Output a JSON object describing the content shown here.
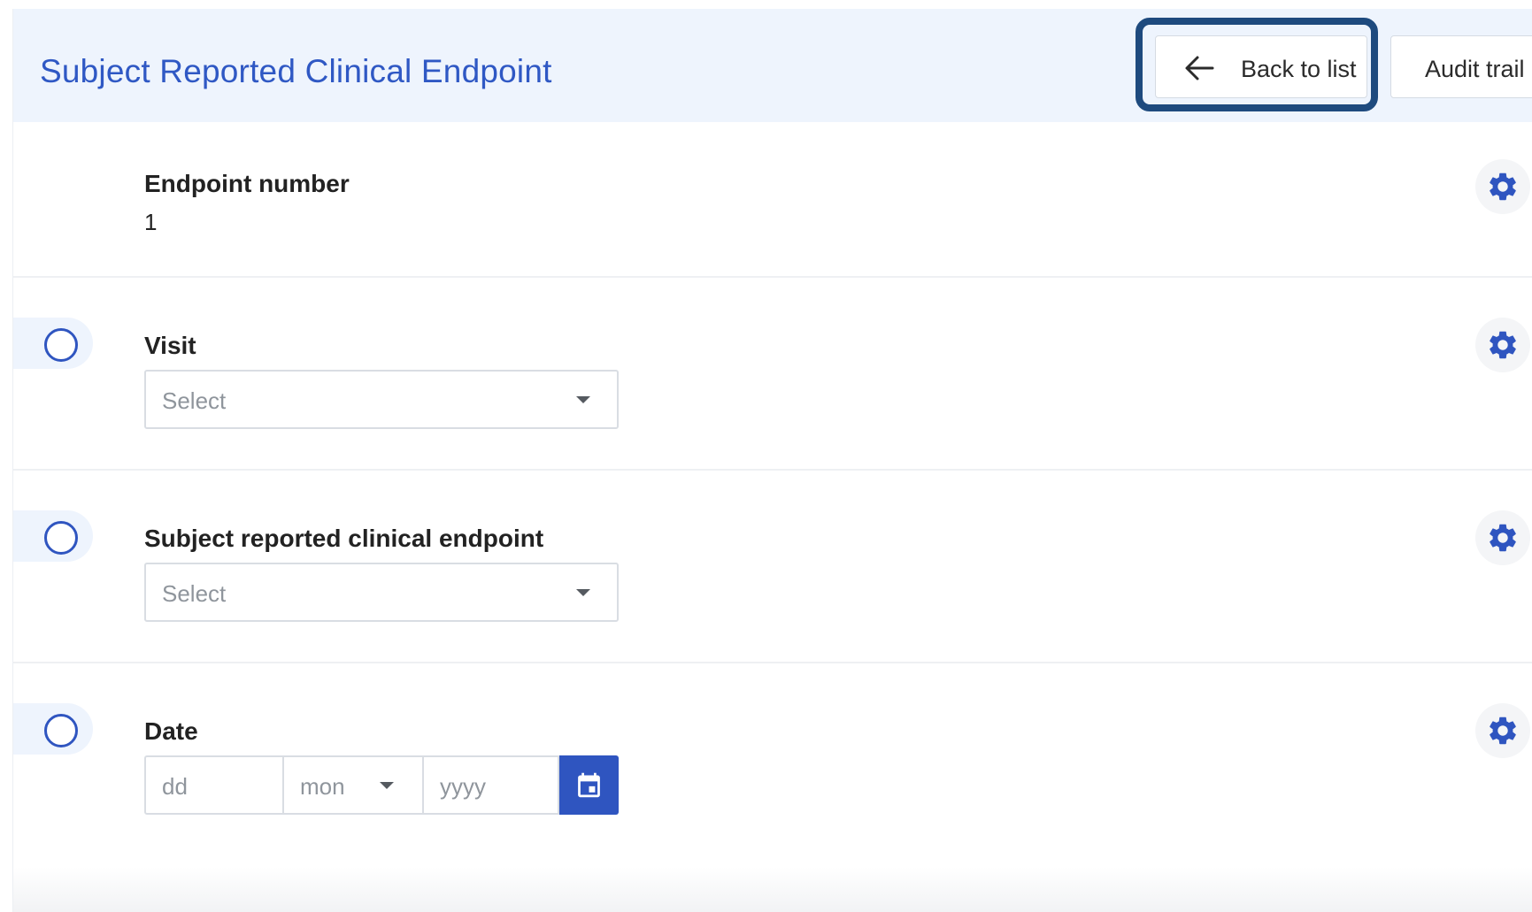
{
  "header": {
    "title": "Subject Reported Clinical Endpoint",
    "back_label": "Back to list",
    "audit_label": "Audit trail"
  },
  "fields": {
    "endpoint_number": {
      "label": "Endpoint number",
      "value": "1"
    },
    "visit": {
      "label": "Visit",
      "placeholder": "Select"
    },
    "endpoint": {
      "label": "Subject reported clinical endpoint",
      "placeholder": "Select"
    },
    "date": {
      "label": "Date",
      "day_placeholder": "dd",
      "month_placeholder": "mon",
      "year_placeholder": "yyyy"
    }
  },
  "icons": {
    "back": "arrow-left-icon",
    "settings": "gear-icon",
    "status": "circle-outline-icon",
    "calendar": "calendar-icon",
    "dropdown": "caret-down-icon"
  },
  "colors": {
    "accent": "#2f55c0",
    "header_bg": "#eef4fd",
    "highlight_border": "#1e4a7e",
    "title": "#2f58c4"
  }
}
